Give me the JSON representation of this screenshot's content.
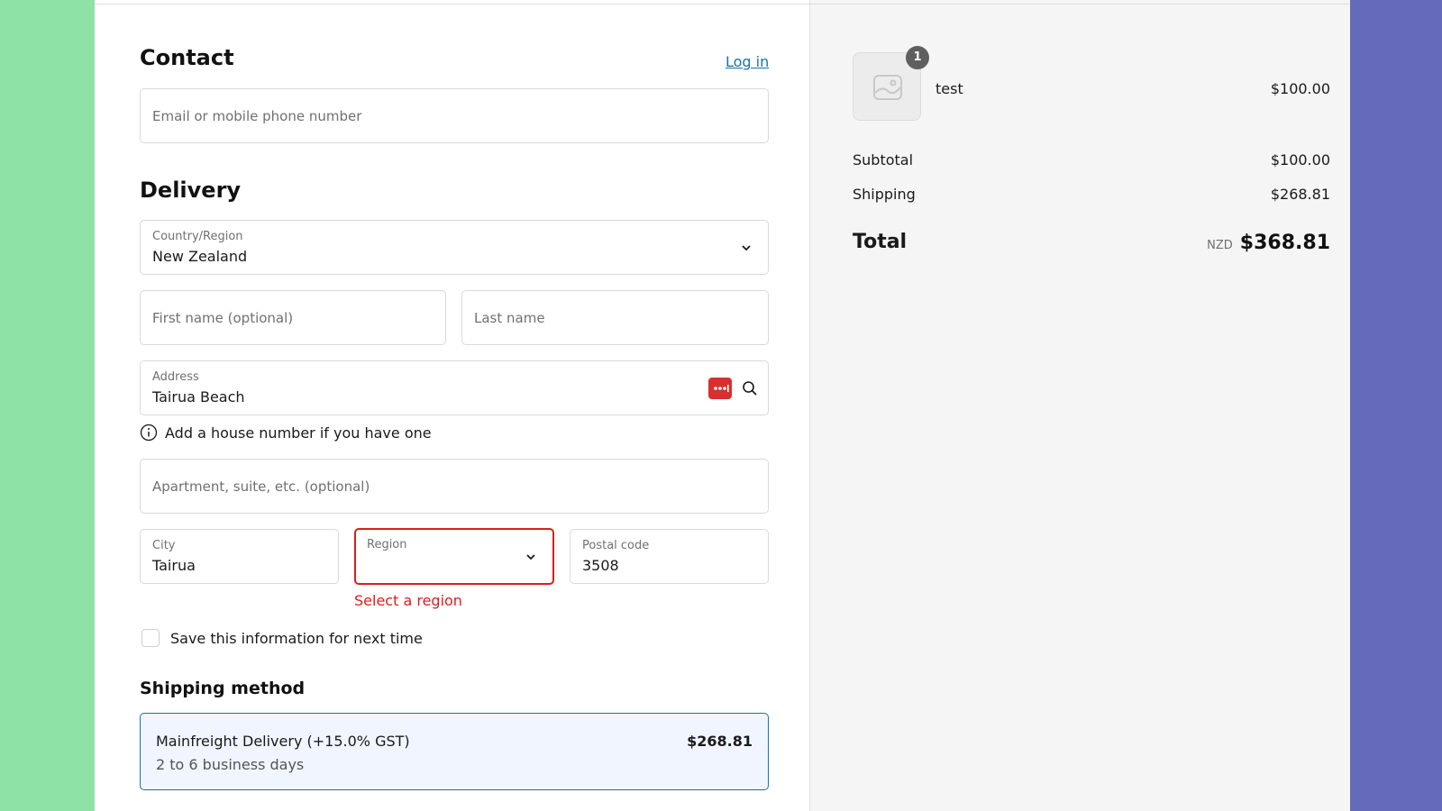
{
  "contact": {
    "heading": "Contact",
    "login_link": "Log in",
    "email_placeholder": "Email or mobile phone number"
  },
  "delivery": {
    "heading": "Delivery",
    "country": {
      "label": "Country/Region",
      "value": "New Zealand"
    },
    "first_name_placeholder": "First name (optional)",
    "last_name_placeholder": "Last name",
    "address": {
      "label": "Address",
      "value": "Tairua Beach"
    },
    "address_hint": "Add a house number if you have one",
    "apartment_placeholder": "Apartment, suite, etc. (optional)",
    "city": {
      "label": "City",
      "value": "Tairua"
    },
    "region": {
      "label": "Region",
      "value": "",
      "error": "Select a region"
    },
    "postal": {
      "label": "Postal code",
      "value": "3508"
    },
    "save_info_label": "Save this information for next time"
  },
  "shipping": {
    "heading": "Shipping method",
    "option": {
      "name": "Mainfreight Delivery (+15.0% GST)",
      "days": "2 to 6 business days",
      "price": "$268.81"
    }
  },
  "summary": {
    "item": {
      "quantity": "1",
      "name": "test",
      "price": "$100.00"
    },
    "subtotal_label": "Subtotal",
    "subtotal_value": "$100.00",
    "shipping_label": "Shipping",
    "shipping_value": "$268.81",
    "total_label": "Total",
    "currency": "NZD",
    "total_value": "$368.81"
  },
  "colors": {
    "accent": "#1773b0",
    "error": "#dd1d1d",
    "left_bg": "#8fe2a6",
    "right_bg": "#656bb8"
  }
}
